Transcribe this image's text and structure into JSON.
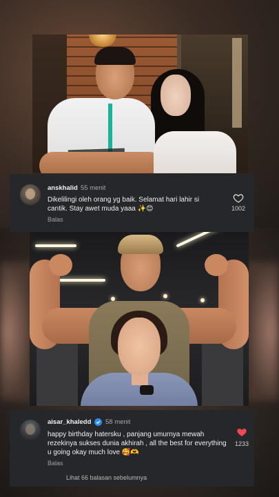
{
  "comments": [
    {
      "username": "anskhalid",
      "time": "55 menit",
      "text": "Dikelilingi oleh orang yg baik. Selamat hari lahir si cantik. Stay awet muda yaaa ✨😊",
      "reply_label": "Balas",
      "likes": "1002",
      "liked": false,
      "verified": false
    },
    {
      "username": "aisar_khaledd",
      "time": "58 menit",
      "text": "happy birthday hatersku , panjang umurnya mewah rezekinya sukses dunia akhirah , all the best for everything u going okay much love 🥰🫶",
      "reply_label": "Balas",
      "likes": "1233",
      "liked": true,
      "verified": true,
      "view_replies": "Lihat 66 balasan sebelumnya"
    }
  ],
  "colors": {
    "card_bg": "#25272a",
    "heart_liked": "#ed4956",
    "verified": "#2d8cf0"
  }
}
